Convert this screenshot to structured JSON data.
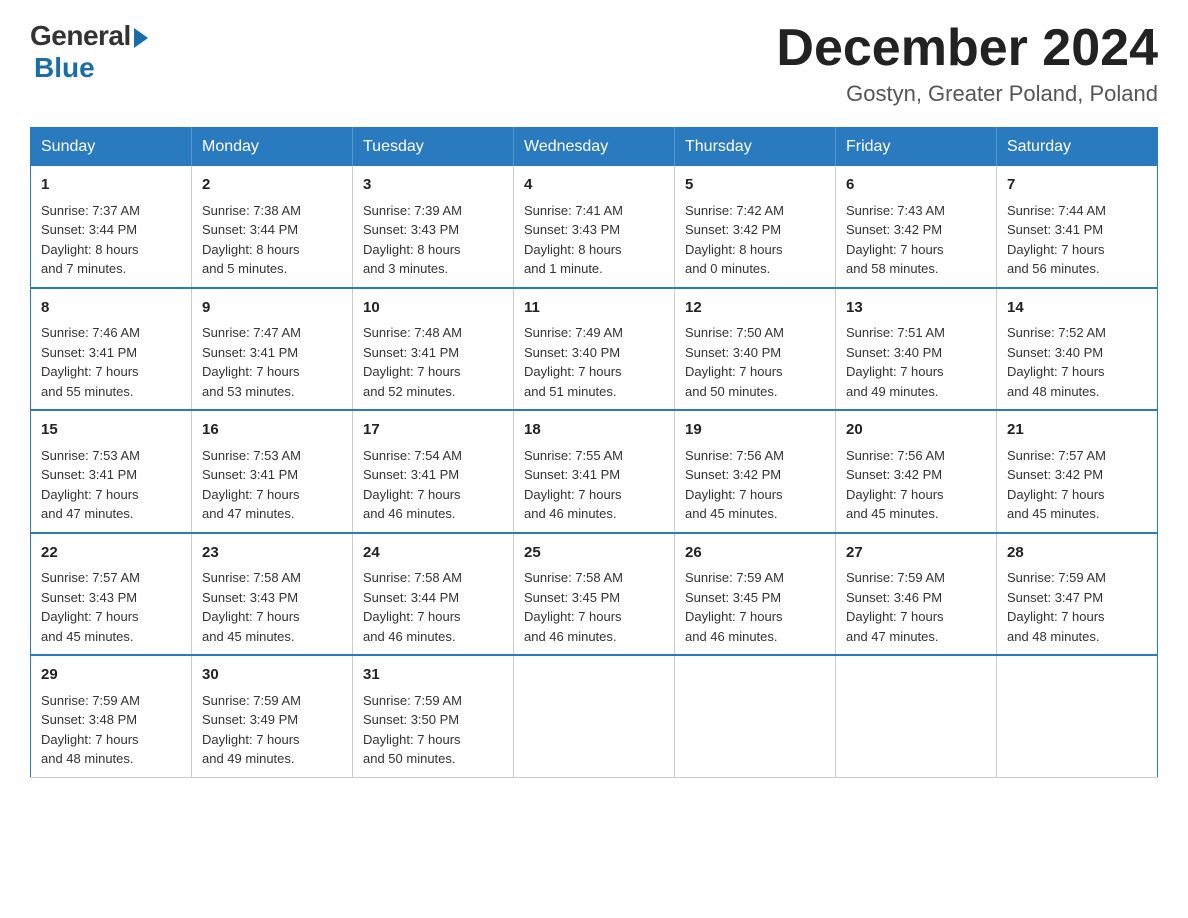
{
  "logo": {
    "general": "General",
    "blue": "Blue"
  },
  "header": {
    "month": "December 2024",
    "location": "Gostyn, Greater Poland, Poland"
  },
  "days_of_week": [
    "Sunday",
    "Monday",
    "Tuesday",
    "Wednesday",
    "Thursday",
    "Friday",
    "Saturday"
  ],
  "weeks": [
    [
      {
        "day": "1",
        "sunrise": "7:37 AM",
        "sunset": "3:44 PM",
        "daylight": "8 hours and 7 minutes."
      },
      {
        "day": "2",
        "sunrise": "7:38 AM",
        "sunset": "3:44 PM",
        "daylight": "8 hours and 5 minutes."
      },
      {
        "day": "3",
        "sunrise": "7:39 AM",
        "sunset": "3:43 PM",
        "daylight": "8 hours and 3 minutes."
      },
      {
        "day": "4",
        "sunrise": "7:41 AM",
        "sunset": "3:43 PM",
        "daylight": "8 hours and 1 minute."
      },
      {
        "day": "5",
        "sunrise": "7:42 AM",
        "sunset": "3:42 PM",
        "daylight": "8 hours and 0 minutes."
      },
      {
        "day": "6",
        "sunrise": "7:43 AM",
        "sunset": "3:42 PM",
        "daylight": "7 hours and 58 minutes."
      },
      {
        "day": "7",
        "sunrise": "7:44 AM",
        "sunset": "3:41 PM",
        "daylight": "7 hours and 56 minutes."
      }
    ],
    [
      {
        "day": "8",
        "sunrise": "7:46 AM",
        "sunset": "3:41 PM",
        "daylight": "7 hours and 55 minutes."
      },
      {
        "day": "9",
        "sunrise": "7:47 AM",
        "sunset": "3:41 PM",
        "daylight": "7 hours and 53 minutes."
      },
      {
        "day": "10",
        "sunrise": "7:48 AM",
        "sunset": "3:41 PM",
        "daylight": "7 hours and 52 minutes."
      },
      {
        "day": "11",
        "sunrise": "7:49 AM",
        "sunset": "3:40 PM",
        "daylight": "7 hours and 51 minutes."
      },
      {
        "day": "12",
        "sunrise": "7:50 AM",
        "sunset": "3:40 PM",
        "daylight": "7 hours and 50 minutes."
      },
      {
        "day": "13",
        "sunrise": "7:51 AM",
        "sunset": "3:40 PM",
        "daylight": "7 hours and 49 minutes."
      },
      {
        "day": "14",
        "sunrise": "7:52 AM",
        "sunset": "3:40 PM",
        "daylight": "7 hours and 48 minutes."
      }
    ],
    [
      {
        "day": "15",
        "sunrise": "7:53 AM",
        "sunset": "3:41 PM",
        "daylight": "7 hours and 47 minutes."
      },
      {
        "day": "16",
        "sunrise": "7:53 AM",
        "sunset": "3:41 PM",
        "daylight": "7 hours and 47 minutes."
      },
      {
        "day": "17",
        "sunrise": "7:54 AM",
        "sunset": "3:41 PM",
        "daylight": "7 hours and 46 minutes."
      },
      {
        "day": "18",
        "sunrise": "7:55 AM",
        "sunset": "3:41 PM",
        "daylight": "7 hours and 46 minutes."
      },
      {
        "day": "19",
        "sunrise": "7:56 AM",
        "sunset": "3:42 PM",
        "daylight": "7 hours and 45 minutes."
      },
      {
        "day": "20",
        "sunrise": "7:56 AM",
        "sunset": "3:42 PM",
        "daylight": "7 hours and 45 minutes."
      },
      {
        "day": "21",
        "sunrise": "7:57 AM",
        "sunset": "3:42 PM",
        "daylight": "7 hours and 45 minutes."
      }
    ],
    [
      {
        "day": "22",
        "sunrise": "7:57 AM",
        "sunset": "3:43 PM",
        "daylight": "7 hours and 45 minutes."
      },
      {
        "day": "23",
        "sunrise": "7:58 AM",
        "sunset": "3:43 PM",
        "daylight": "7 hours and 45 minutes."
      },
      {
        "day": "24",
        "sunrise": "7:58 AM",
        "sunset": "3:44 PM",
        "daylight": "7 hours and 46 minutes."
      },
      {
        "day": "25",
        "sunrise": "7:58 AM",
        "sunset": "3:45 PM",
        "daylight": "7 hours and 46 minutes."
      },
      {
        "day": "26",
        "sunrise": "7:59 AM",
        "sunset": "3:45 PM",
        "daylight": "7 hours and 46 minutes."
      },
      {
        "day": "27",
        "sunrise": "7:59 AM",
        "sunset": "3:46 PM",
        "daylight": "7 hours and 47 minutes."
      },
      {
        "day": "28",
        "sunrise": "7:59 AM",
        "sunset": "3:47 PM",
        "daylight": "7 hours and 48 minutes."
      }
    ],
    [
      {
        "day": "29",
        "sunrise": "7:59 AM",
        "sunset": "3:48 PM",
        "daylight": "7 hours and 48 minutes."
      },
      {
        "day": "30",
        "sunrise": "7:59 AM",
        "sunset": "3:49 PM",
        "daylight": "7 hours and 49 minutes."
      },
      {
        "day": "31",
        "sunrise": "7:59 AM",
        "sunset": "3:50 PM",
        "daylight": "7 hours and 50 minutes."
      },
      null,
      null,
      null,
      null
    ]
  ],
  "labels": {
    "sunrise": "Sunrise:",
    "sunset": "Sunset:",
    "daylight": "Daylight:"
  }
}
